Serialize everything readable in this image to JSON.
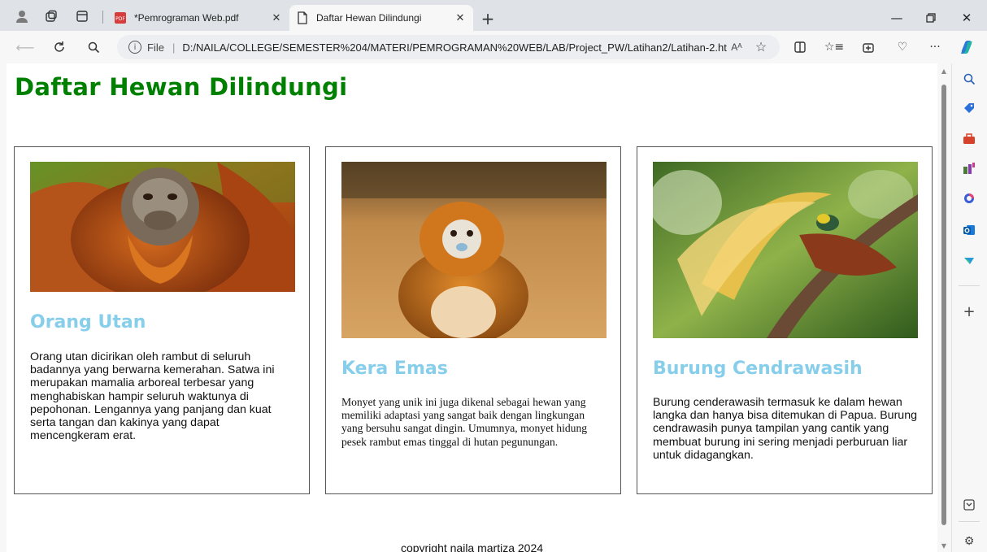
{
  "browser": {
    "tabs": [
      {
        "title": "*Pemrograman Web.pdf",
        "icon": "pdf-icon",
        "active": false
      },
      {
        "title": "Daftar Hewan Dilindungi",
        "icon": "document-icon",
        "active": true
      }
    ],
    "address": {
      "scheme": "File",
      "url": "D:/NAILA/COLLEGE/SEMESTER%204/MATERI/PEMROGRAMAN%20WEB/LAB/Project_PW/Latihan2/Latihan-2.ht...",
      "read_aloud": "Aᴬ"
    }
  },
  "page": {
    "title": "Daftar Hewan Dilindungi",
    "animals": [
      {
        "name": "Orang Utan",
        "description": "Orang utan dicirikan oleh rambut di seluruh badannya yang berwarna kemerahan. Satwa ini merupakan mamalia arboreal terbesar yang menghabiskan hampir seluruh waktunya di pepohonan. Lengannya yang panjang dan kuat serta tangan dan kakinya yang dapat mencengkeram erat.",
        "image": "orangutan-photo"
      },
      {
        "name": "Kera Emas",
        "description": "Monyet yang unik ini juga dikenal sebagai hewan yang memiliki adaptasi yang sangat baik dengan lingkungan yang bersuhu sangat dingin. Umumnya, monyet hidung pesek rambut emas tinggal di hutan pegunungan.",
        "image": "golden-monkey-photo"
      },
      {
        "name": "Burung Cendrawasih",
        "description": "Burung cenderawasih termasuk ke dalam hewan langka dan hanya bisa ditemukan di Papua. Burung cendrawasih punya tampilan yang cantik yang membuat burung ini sering menjadi perburuan liar untuk didagangkan.",
        "image": "bird-of-paradise-photo"
      }
    ],
    "footer": "copyright naila martiza 2024"
  },
  "colors": {
    "title": "#008000",
    "heading": "#87ceeb",
    "tabbar": "#dfe3e8"
  }
}
